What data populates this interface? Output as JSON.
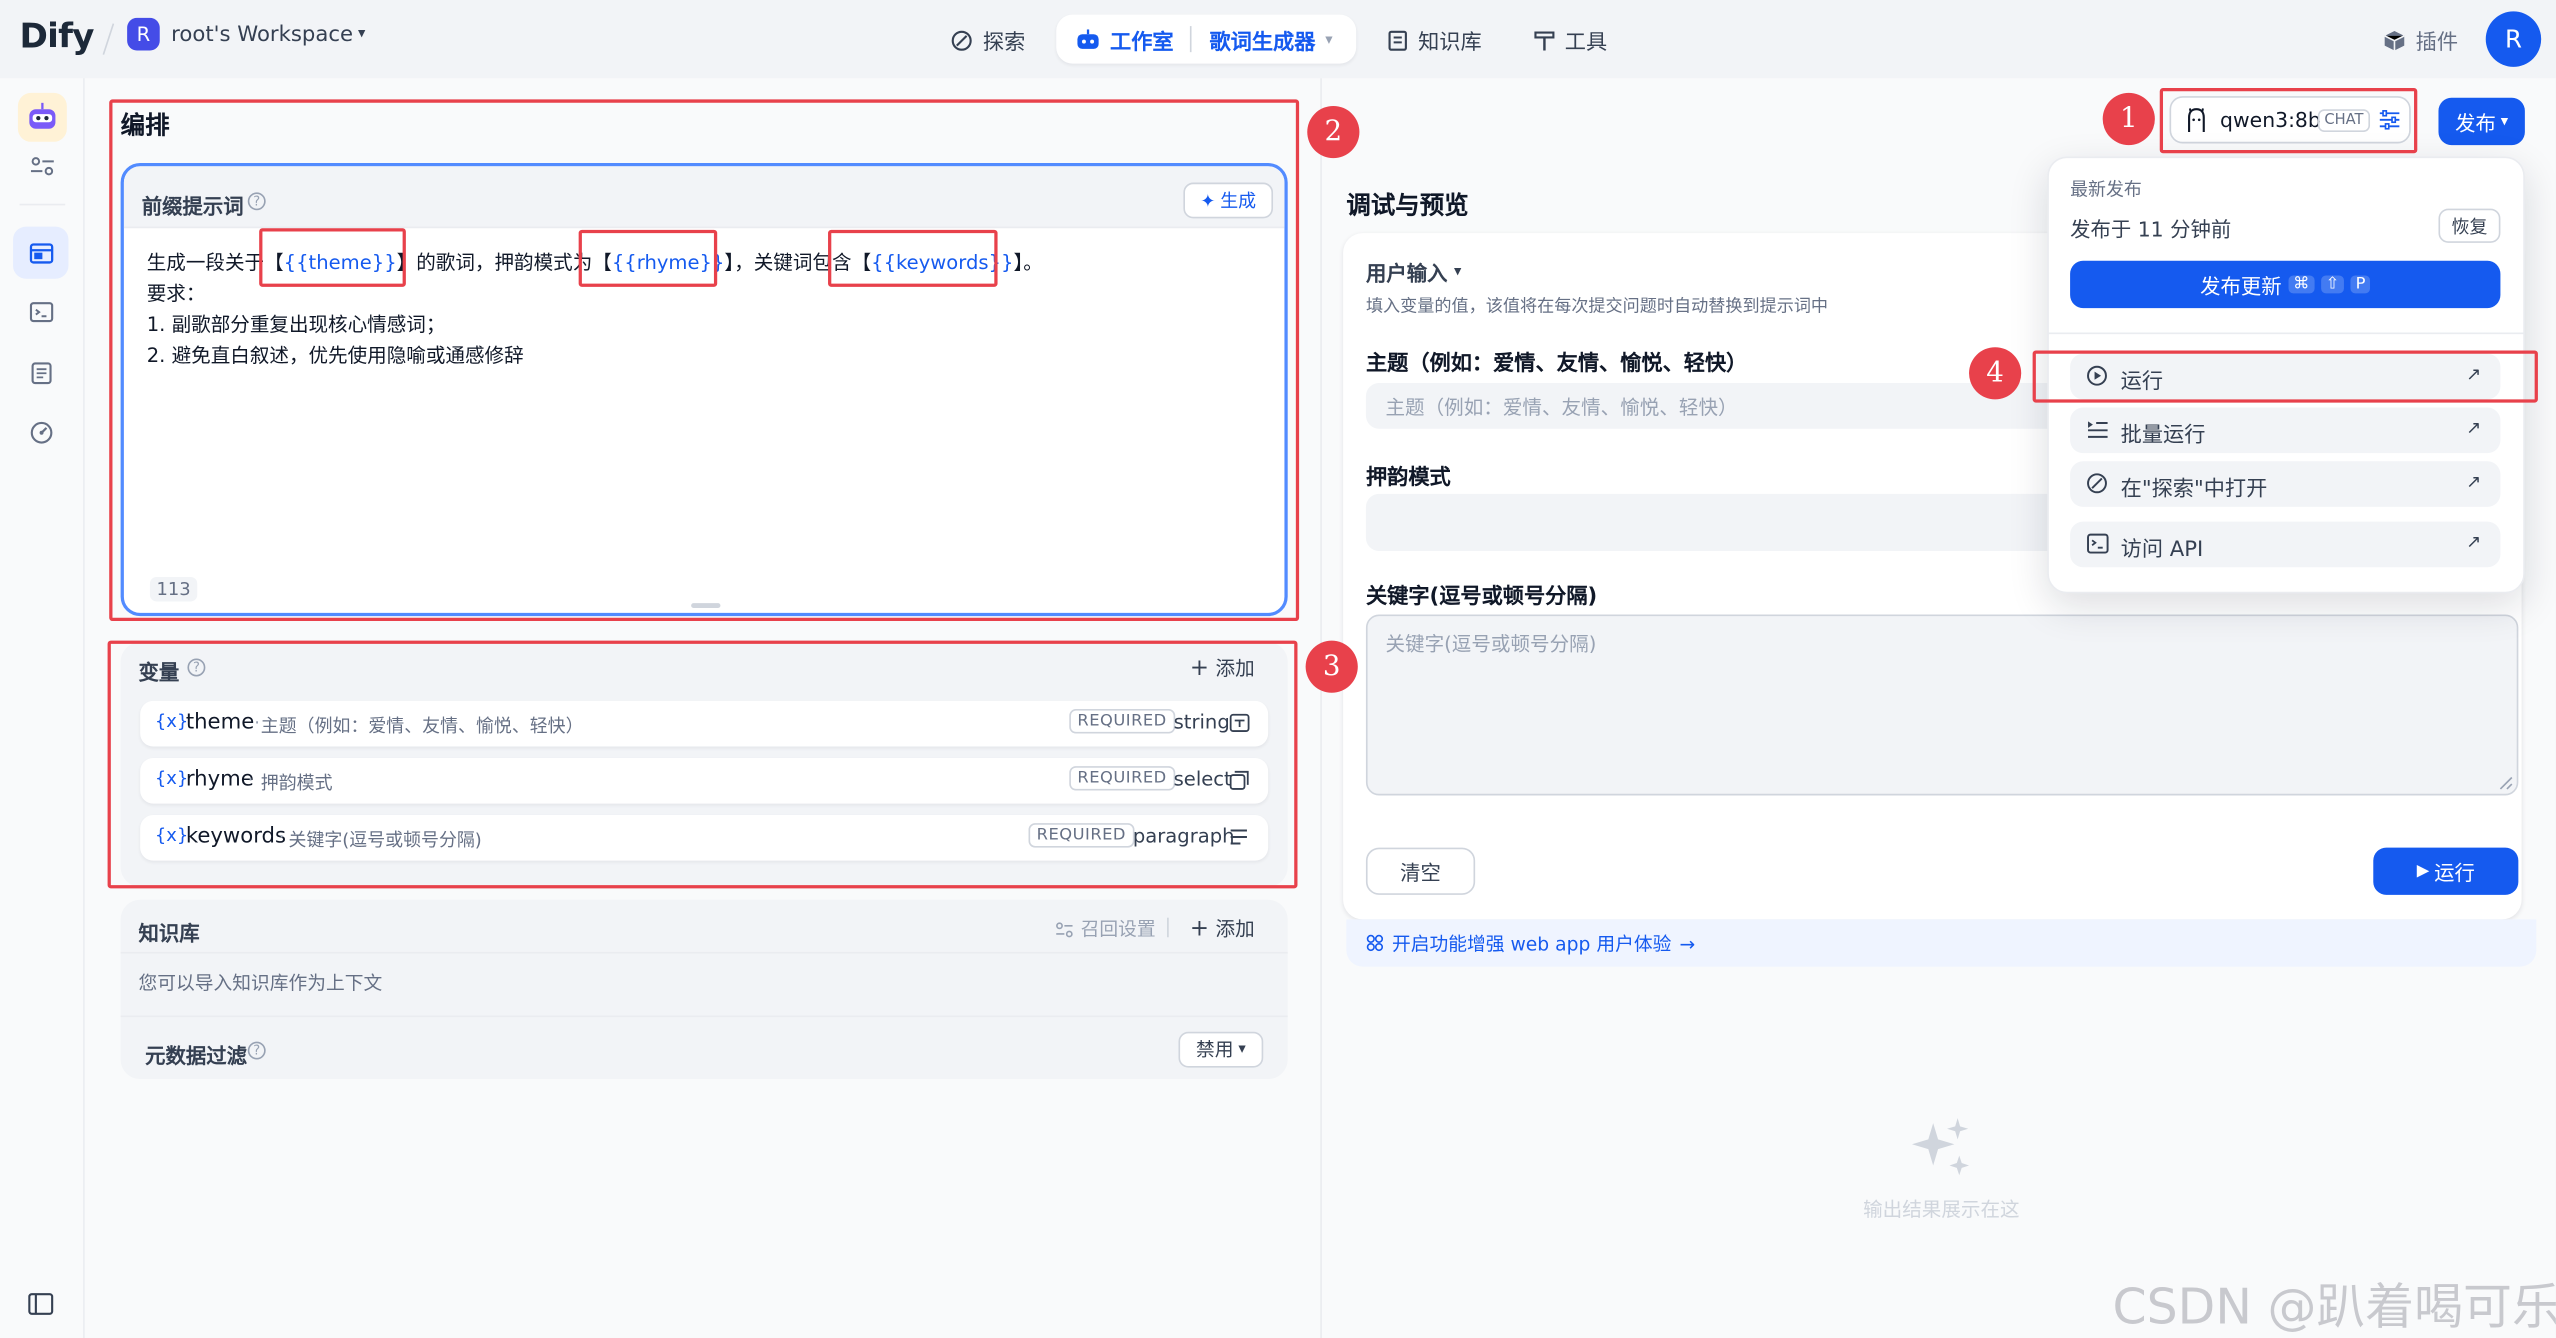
{
  "app": {
    "logo": "Dify"
  },
  "workspace": {
    "avatar_letter": "R",
    "name": "root's Workspace"
  },
  "nav": {
    "explore": "探索",
    "studio": "工作室",
    "app_name": "歌词生成器",
    "knowledge": "知识库",
    "tools": "工具",
    "plugins": "插件",
    "user_initial": "R"
  },
  "editor": {
    "title": "编排",
    "prompt": {
      "label": "前缀提示词",
      "generate": "生成",
      "line1_a": "生成一段关于",
      "line1_b": "【",
      "var_theme": "{{theme}}",
      "line1_c": "】的歌词，押韵模式为",
      "line1_d": "【",
      "var_rhyme": "{{rhyme}}",
      "line1_e": "】，关键词包含",
      "line1_f": "【",
      "var_keywords": "{{keywords}}",
      "line1_g": "】。",
      "line2": "要求：",
      "line3": "1. 副歌部分重复出现核心情感词；",
      "line4": "2. 避免直白叙述，优先使用隐喻或通感修辞",
      "char_count": "113"
    },
    "variables": {
      "label": "变量",
      "add": "添加",
      "items": [
        {
          "icon": "{x}",
          "name": "theme",
          "desc": "主题（例如：爱情、友情、愉悦、轻快）",
          "required": "REQUIRED",
          "type": "string"
        },
        {
          "icon": "{x}",
          "name": "rhyme",
          "desc": "押韵模式",
          "required": "REQUIRED",
          "type": "select"
        },
        {
          "icon": "{x}",
          "name": "keywords",
          "desc": "关键字(逗号或顿号分隔)",
          "required": "REQUIRED",
          "type": "paragraph"
        }
      ]
    },
    "knowledge": {
      "label": "知识库",
      "recall": "召回设置",
      "add": "添加",
      "hint": "您可以导入知识库作为上下文"
    },
    "metadata": {
      "label": "元数据过滤",
      "value": "禁用"
    }
  },
  "model": {
    "name": "qwen3:8b",
    "badge": "CHAT"
  },
  "publish": {
    "button": "发布",
    "latest_label": "最新发布",
    "published_time": "发布于 11 分钟前",
    "restore": "恢复",
    "update": "发布更新",
    "shortcut_1": "⌘",
    "shortcut_2": "⇧",
    "shortcut_3": "P",
    "menu": [
      "运行",
      "批量运行",
      "在\"探索\"中打开",
      "访问 API"
    ]
  },
  "preview": {
    "title": "调试与预览",
    "user_input": "用户输入",
    "hint": "填入变量的值，该值将在每次提交问题时自动替换到提示词中",
    "field_theme_label": "主题（例如：爱情、友情、愉悦、轻快）",
    "field_theme_placeholder": "主题（例如：爱情、友情、愉悦、轻快）",
    "field_rhyme_label": "押韵模式",
    "field_keywords_label": "关键字(逗号或顿号分隔)",
    "field_keywords_placeholder": "关键字(逗号或顿号分隔)",
    "clear": "清空",
    "run": "运行",
    "enhance": "开启功能增强 web app 用户体验",
    "empty": "输出结果展示在这"
  },
  "annotations": [
    "1",
    "2",
    "3",
    "4"
  ],
  "watermark": "CSDN @趴着喝可乐",
  "colors": {
    "accent": "#155aef",
    "highlight": "#e8414b",
    "variable": "#155aef"
  }
}
